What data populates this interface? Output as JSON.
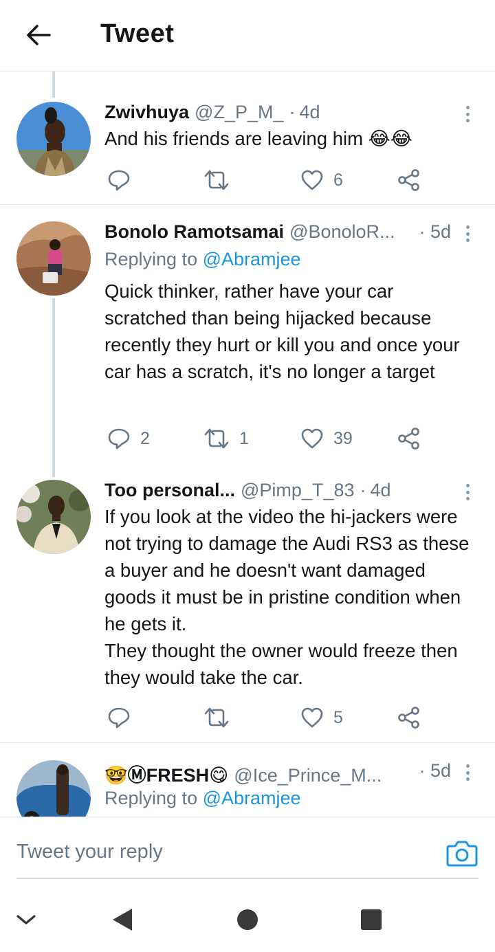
{
  "header": {
    "title": "Tweet"
  },
  "tweets": [
    {
      "name": "Zwivhuya",
      "handle": "@Z_P_M_",
      "time": "4d",
      "text": "And his friends are leaving him 😂😂",
      "reply_count": "",
      "retweet_count": "",
      "like_count": "6"
    },
    {
      "name": "Bonolo Ramotsamai",
      "handle": "@BonoloR...",
      "time": "5d",
      "replying_prefix": "Replying to ",
      "replying_to": "@Abramjee",
      "text": "Quick thinker, rather have your car scratched than being hijacked because recently they hurt or kill you and once your car has a scratch, it's no longer a target",
      "reply_count": "2",
      "retweet_count": "1",
      "like_count": "39"
    },
    {
      "name": "Too personal...",
      "handle": "@Pimp_T_83",
      "time": "4d",
      "text": "If you look at the video the hi-jackers were not trying to damage the Audi RS3 as these a buyer and he doesn't want damaged goods it must be in pristine condition when he gets it.\nThey thought the owner would freeze then they would take the car.",
      "reply_count": "",
      "retweet_count": "",
      "like_count": "5"
    },
    {
      "name": "🤓ⓂFRESH😋",
      "handle": "@Ice_Prince_M...",
      "time": "5d",
      "replying_prefix": "Replying to ",
      "replying_to": "@Abramjee"
    }
  ],
  "composer": {
    "placeholder": "Tweet your reply"
  },
  "icons": {
    "back": "arrow-left-icon",
    "reply": "reply-icon",
    "retweet": "retweet-icon",
    "like": "heart-icon",
    "share": "share-icon",
    "more": "more-vertical-icon",
    "camera": "camera-icon"
  },
  "colors": {
    "accent": "#1b95e0",
    "muted": "#657786",
    "text": "#14171a",
    "divider": "#e1e8ed"
  }
}
